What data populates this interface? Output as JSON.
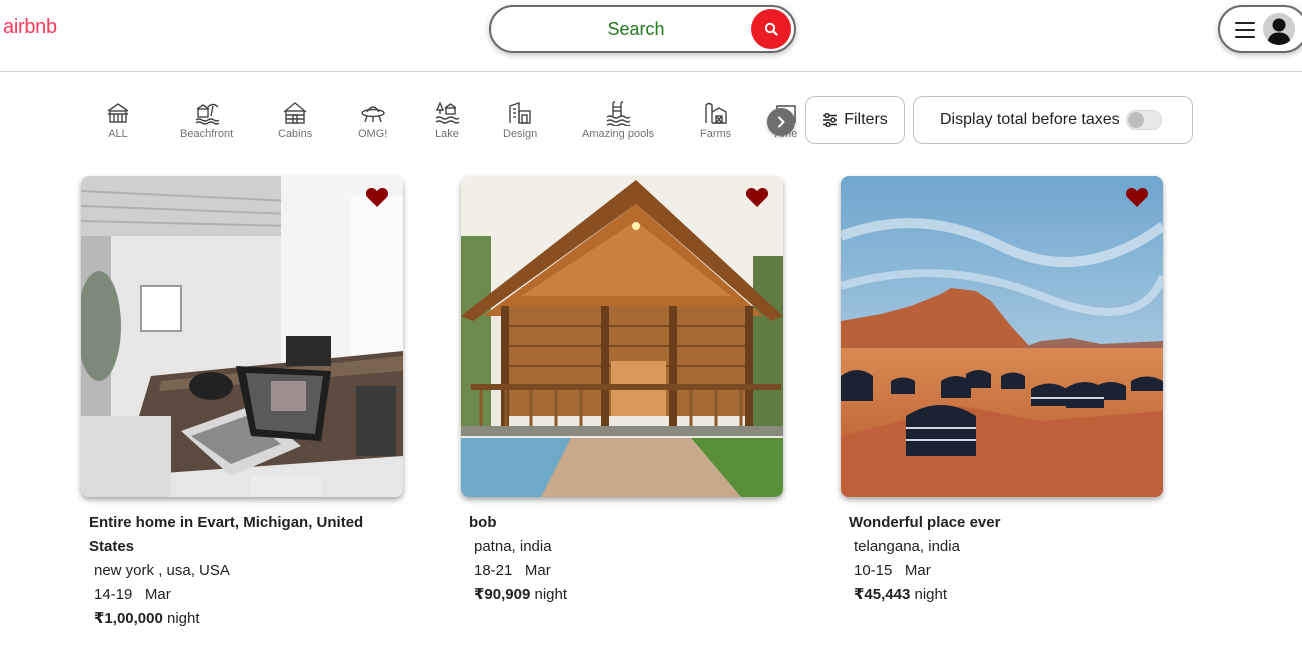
{
  "header": {
    "logo": "airbnb",
    "search_placeholder": "Search"
  },
  "categories": [
    {
      "label": "ALL",
      "icon": "house-icon"
    },
    {
      "label": "Beachfront",
      "icon": "beach-icon"
    },
    {
      "label": "Cabins",
      "icon": "cabin-icon"
    },
    {
      "label": "OMG!",
      "icon": "ufo-icon"
    },
    {
      "label": "Lake",
      "icon": "lake-icon"
    },
    {
      "label": "Design",
      "icon": "design-icon"
    },
    {
      "label": "Amazing pools",
      "icon": "pool-icon"
    },
    {
      "label": "Farms",
      "icon": "farm-icon"
    },
    {
      "label": "Ame",
      "icon": "amenity-icon"
    }
  ],
  "filters": {
    "label": "Filters",
    "taxes_label": "Display total before taxes",
    "taxes_enabled": false
  },
  "listings": [
    {
      "title": "Entire home in Evart, Michigan, United States",
      "location": "new york , usa, USA",
      "dates": "14-19",
      "month": "Mar",
      "price": "₹1,00,000",
      "unit": "night",
      "image": "office-photo"
    },
    {
      "title": "bob",
      "location": "patna, india",
      "dates": "18-21",
      "month": "Mar",
      "price": "₹90,909",
      "unit": "night",
      "image": "cabin-photo"
    },
    {
      "title": "Wonderful place ever",
      "location": "telangana, india",
      "dates": "10-15",
      "month": "Mar",
      "price": "₹45,443",
      "unit": "night",
      "image": "desert-camp-photo"
    }
  ],
  "colors": {
    "brand": "#ff385c",
    "search_button": "#ed1c24",
    "heart": "#8b0000",
    "search_text": "#1f7a1f"
  }
}
